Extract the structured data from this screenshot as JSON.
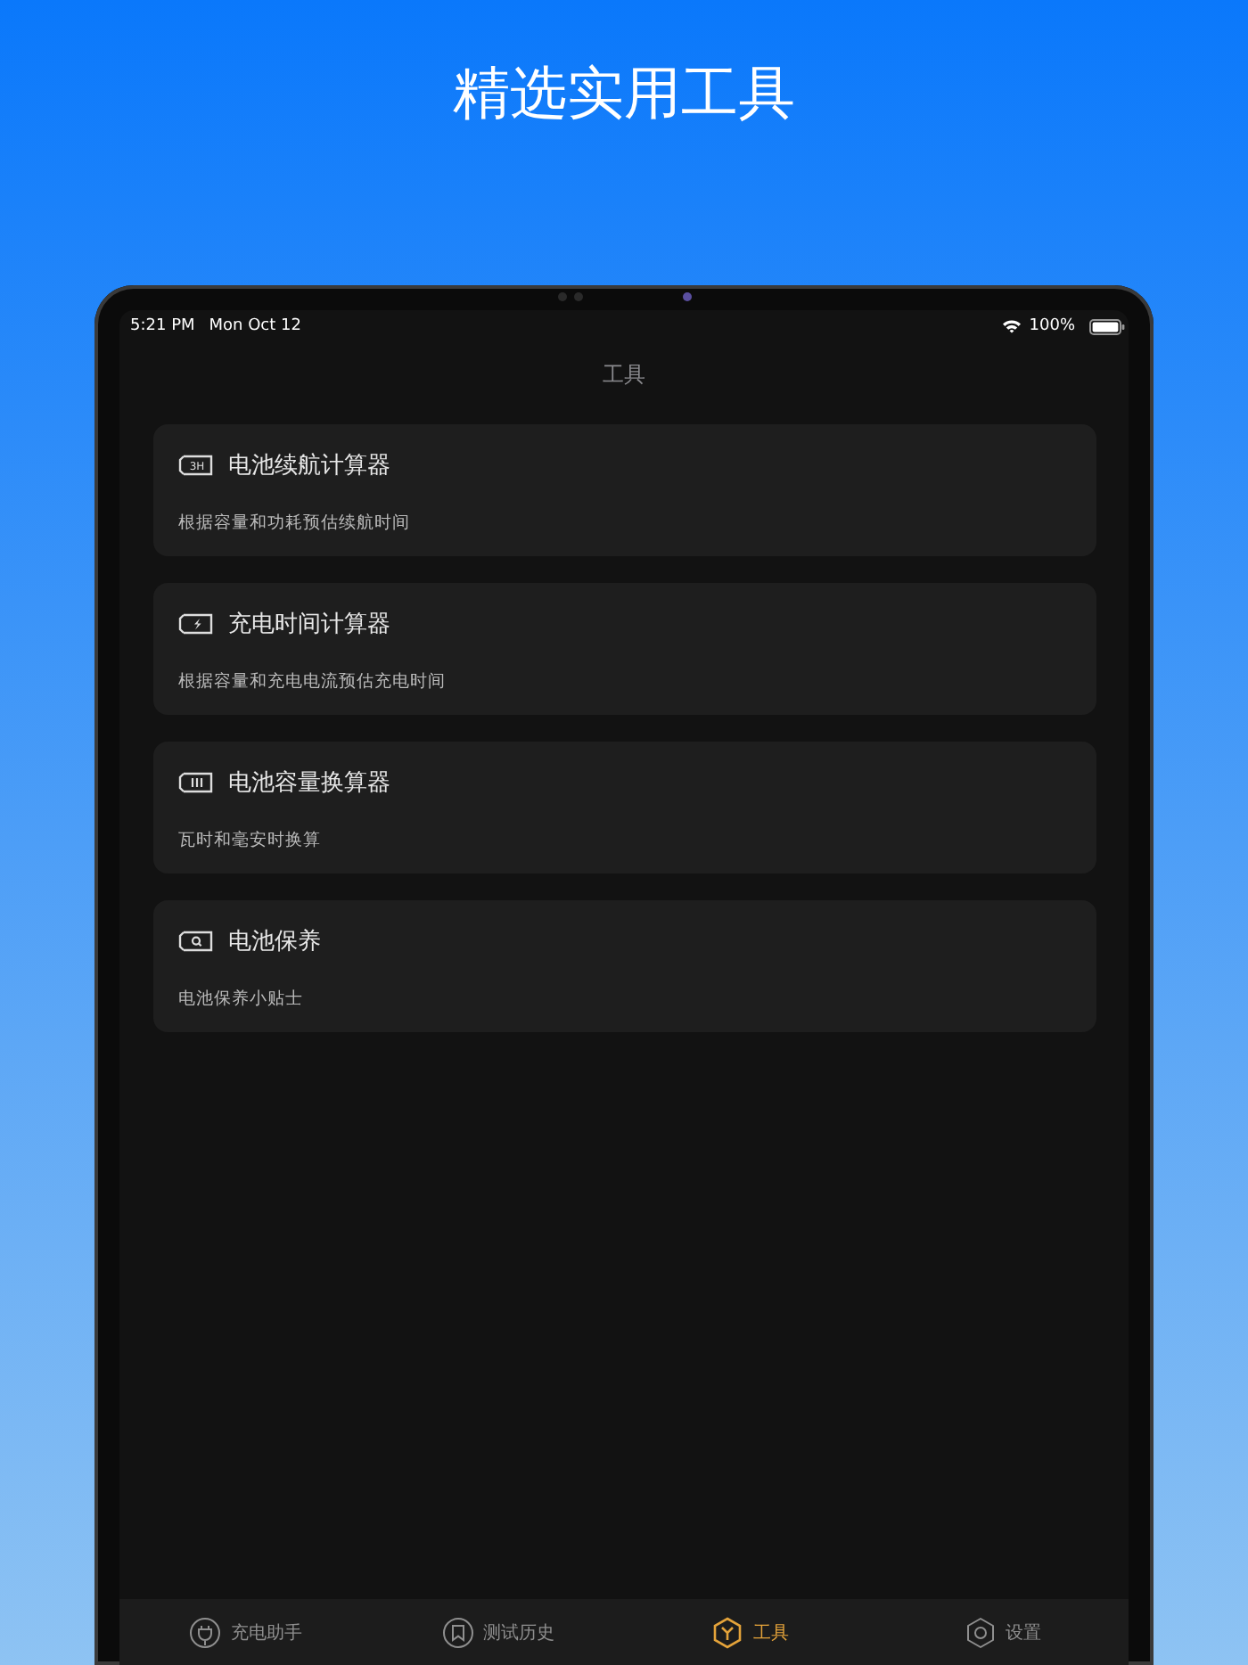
{
  "headline": "精选实用工具",
  "status_bar": {
    "time": "5:21 PM",
    "date": "Mon Oct 12",
    "battery": "100%"
  },
  "nav": {
    "title": "工具"
  },
  "cards": [
    {
      "kind": "hours",
      "icon_text": "3H",
      "title": "电池续航计算器",
      "subtitle": "根据容量和功耗预估续航时间"
    },
    {
      "kind": "charge",
      "title": "充电时间计算器",
      "subtitle": "根据容量和充电电流预估充电时间"
    },
    {
      "kind": "level",
      "title": "电池容量换算器",
      "subtitle": "瓦时和毫安时换算"
    },
    {
      "kind": "search",
      "title": "电池保养",
      "subtitle": "电池保养小贴士"
    }
  ],
  "tab_bar": [
    {
      "kind": "plug",
      "label": "充电助手",
      "selected": false
    },
    {
      "kind": "bookmark",
      "label": "测试历史",
      "selected": false
    },
    {
      "kind": "tools",
      "label": "工具",
      "selected": true
    },
    {
      "kind": "gear",
      "label": "设置",
      "selected": false
    }
  ]
}
